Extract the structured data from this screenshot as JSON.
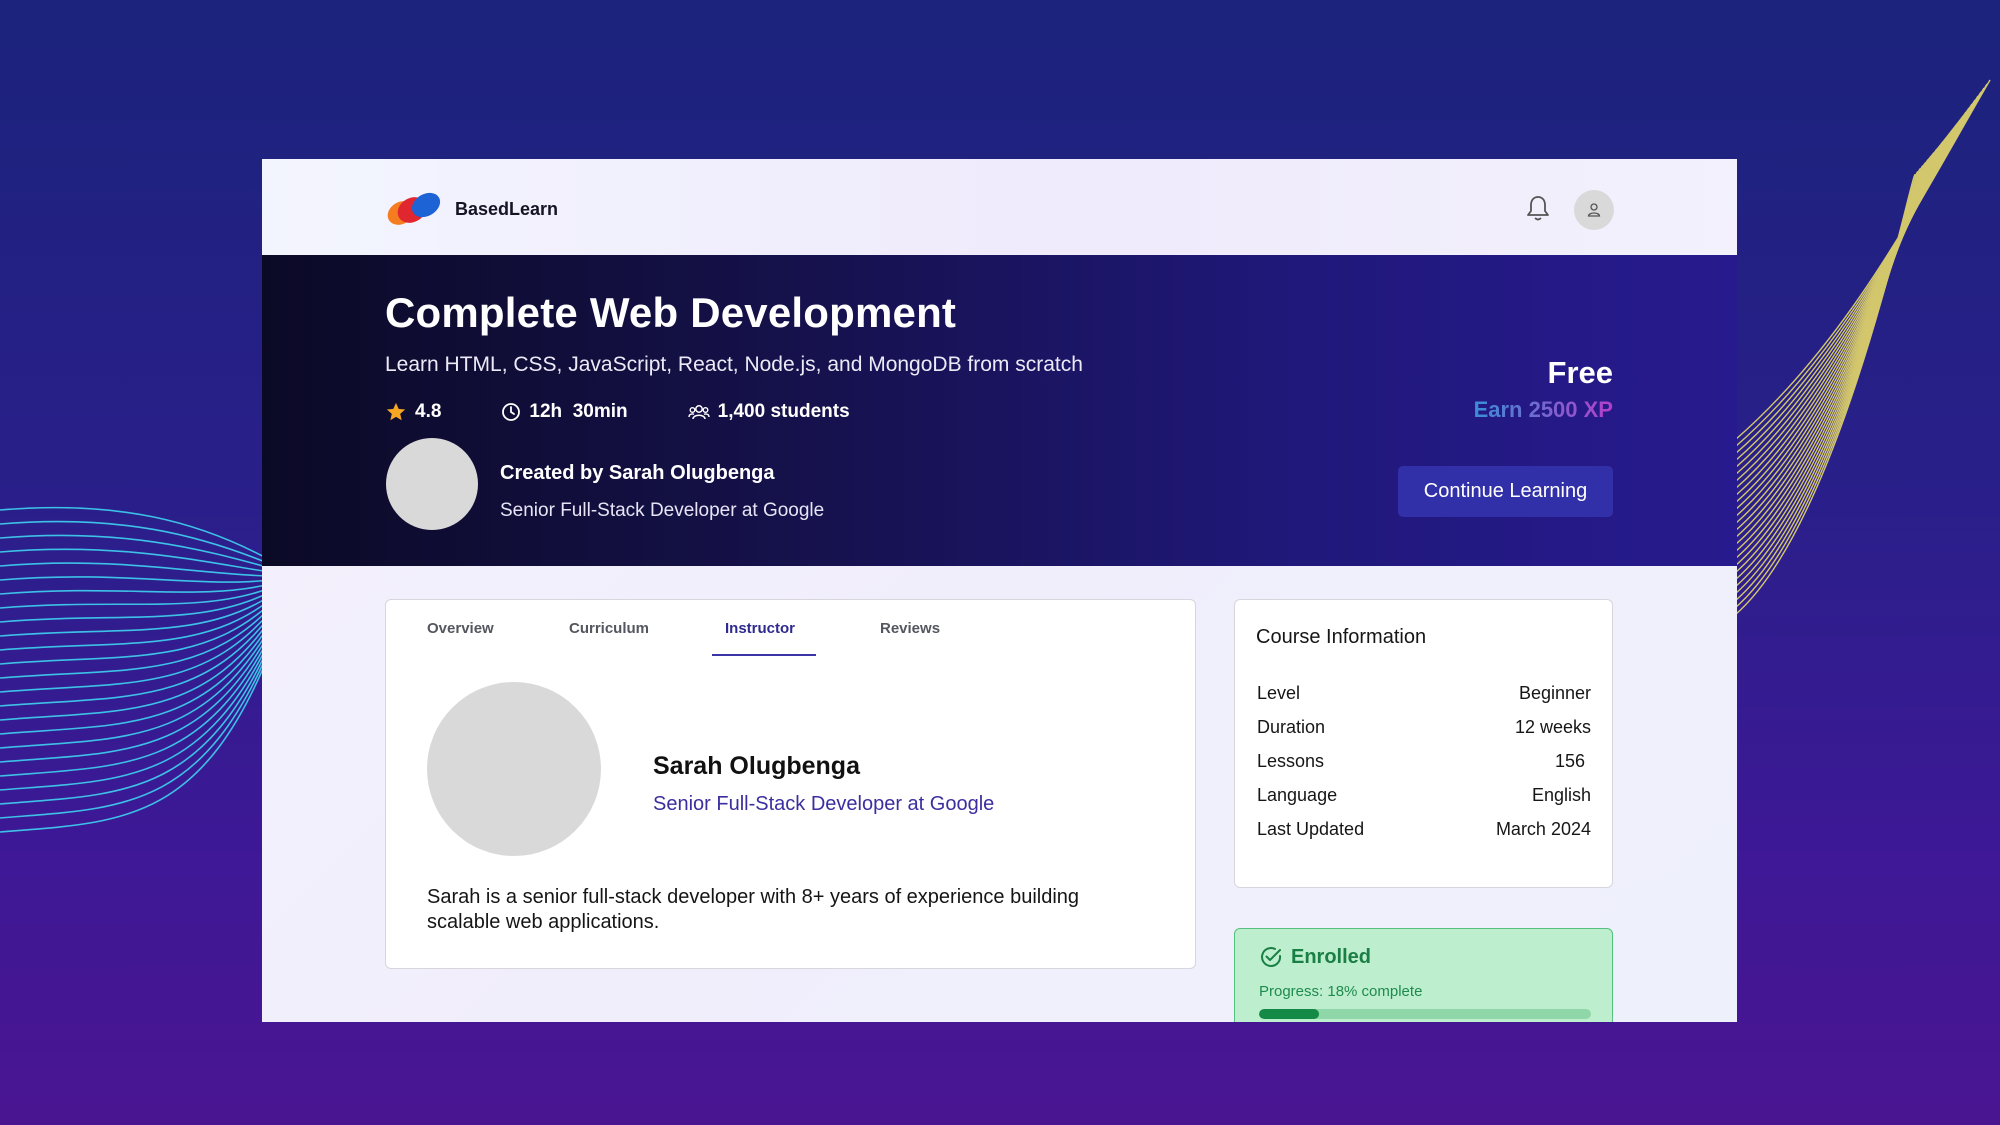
{
  "header": {
    "brand_name": "BasedLearn",
    "icons": [
      "bell-icon",
      "user-icon"
    ]
  },
  "hero": {
    "title": "Complete Web Development",
    "subtitle": "Learn HTML, CSS, JavaScript, React, Node.js, and MongoDB from scratch",
    "rating": "4.8",
    "duration": "12h  30min",
    "students": "1,400 students",
    "creator": "Created by Sarah Olugbenga",
    "creator_role": "Senior Full-Stack Developer at Google",
    "price": "Free",
    "xp": "Earn 2500 XP",
    "cta_label": "Continue Learning"
  },
  "tabs": [
    {
      "label": "Overview",
      "active": false
    },
    {
      "label": "Curriculum",
      "active": false
    },
    {
      "label": "Instructor",
      "active": true
    },
    {
      "label": "Reviews",
      "active": false
    }
  ],
  "instructor": {
    "name": "Sarah Olugbenga",
    "role": "Senior Full-Stack Developer at Google",
    "bio": "Sarah is a senior full-stack developer with 8+ years of experience building scalable web applications."
  },
  "course_info": {
    "title": "Course Information",
    "rows": [
      {
        "label": "Level",
        "value": "Beginner"
      },
      {
        "label": "Duration",
        "value": "12 weeks"
      },
      {
        "label": "Lessons",
        "value": "156"
      },
      {
        "label": "Language",
        "value": "English"
      },
      {
        "label": "Last Updated",
        "value": "March 2024"
      }
    ]
  },
  "enrollment": {
    "status": "Enrolled",
    "progress_text": "Progress: 18% complete",
    "progress_fraction": 0.18
  },
  "colors": {
    "accent": "#3230a8",
    "success": "#1a7f45",
    "star": "#f5a623"
  }
}
